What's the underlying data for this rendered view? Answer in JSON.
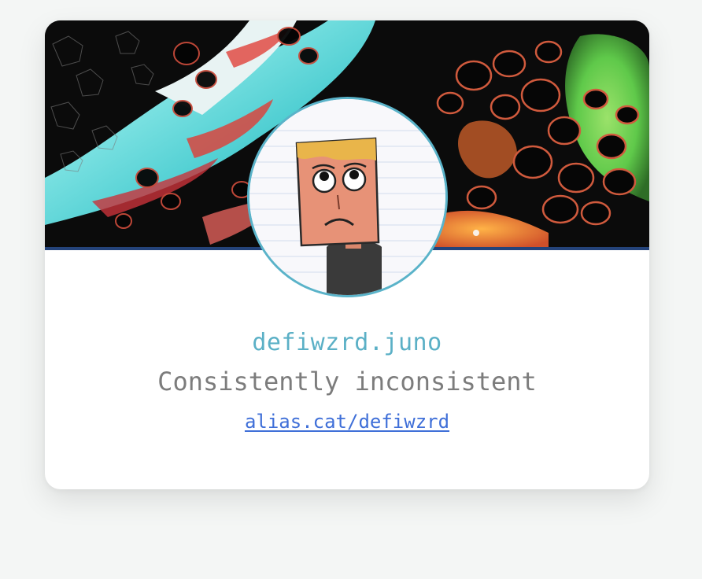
{
  "profile": {
    "name": "defiwzrd.juno",
    "bio": "Consistently inconsistent",
    "link_text": "alias.cat/defiwzrd"
  },
  "colors": {
    "page_background": "#f4f6f5",
    "name": "#5bb0c6",
    "bio": "#7c7c7c",
    "link": "#3f6fd8",
    "avatar_border": "#5ab3c9",
    "banner_rule": "#24437a"
  },
  "images": {
    "banner": "abstract-fluid-art-banner",
    "avatar": "sad-square-head-drawing-avatar"
  }
}
